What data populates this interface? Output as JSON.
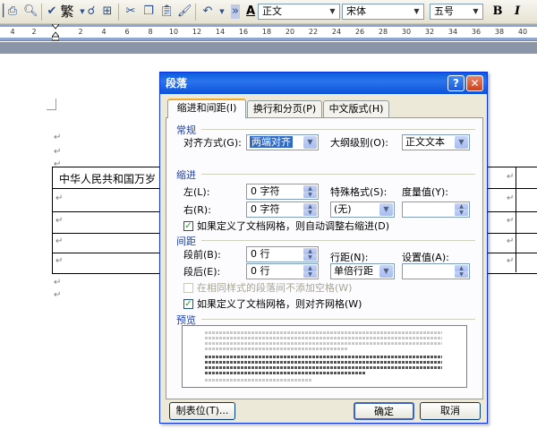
{
  "toolbar": {
    "trad_simplified_label": "繁",
    "style_value": "正文",
    "font_value": "宋体",
    "size_value": "五号",
    "bold_label": "B",
    "italic_label": "I"
  },
  "ruler": {
    "ticks": [
      "4",
      "2",
      "2",
      "4",
      "6",
      "8",
      "10",
      "12",
      "14",
      "16",
      "18",
      "20",
      "22",
      "24",
      "26",
      "28",
      "30",
      "32",
      "34",
      "36",
      "38",
      "40",
      "42"
    ]
  },
  "document": {
    "table_cell_text": "中华人民共和国万岁",
    "paragraph_mark": "↵"
  },
  "dialog": {
    "title": "段落",
    "help_label": "?",
    "close_label": "✕",
    "tabs": [
      {
        "label": "缩进和间距(I)"
      },
      {
        "label": "换行和分页(P)"
      },
      {
        "label": "中文版式(H)"
      }
    ],
    "general": {
      "heading": "常规",
      "alignment_label": "对齐方式(G):",
      "alignment_value": "两端对齐",
      "outline_label": "大纲级别(O):",
      "outline_value": "正文文本"
    },
    "indent": {
      "heading": "缩进",
      "left_label": "左(L):",
      "left_value": "0 字符",
      "right_label": "右(R):",
      "right_value": "0 字符",
      "special_label": "特殊格式(S):",
      "special_value": "(无)",
      "by_label": "度量值(Y):",
      "by_value": "",
      "auto_adjust_label": "如果定义了文档网格，则自动调整右缩进(D)",
      "auto_adjust_checked": "✓"
    },
    "spacing": {
      "heading": "间距",
      "before_label": "段前(B):",
      "before_value": "0 行",
      "after_label": "段后(E):",
      "after_value": "0 行",
      "line_spacing_label": "行距(N):",
      "line_spacing_value": "单倍行距",
      "at_label": "设置值(A):",
      "at_value": "",
      "no_space_label": "在相同样式的段落间不添加空格(W)",
      "snap_grid_label": "如果定义了文档网格，则对齐网格(W)",
      "snap_grid_checked": "✓"
    },
    "preview": {
      "heading": "预览"
    },
    "buttons": {
      "tabs_label": "制表位(T)...",
      "ok_label": "确定",
      "cancel_label": "取消"
    }
  }
}
